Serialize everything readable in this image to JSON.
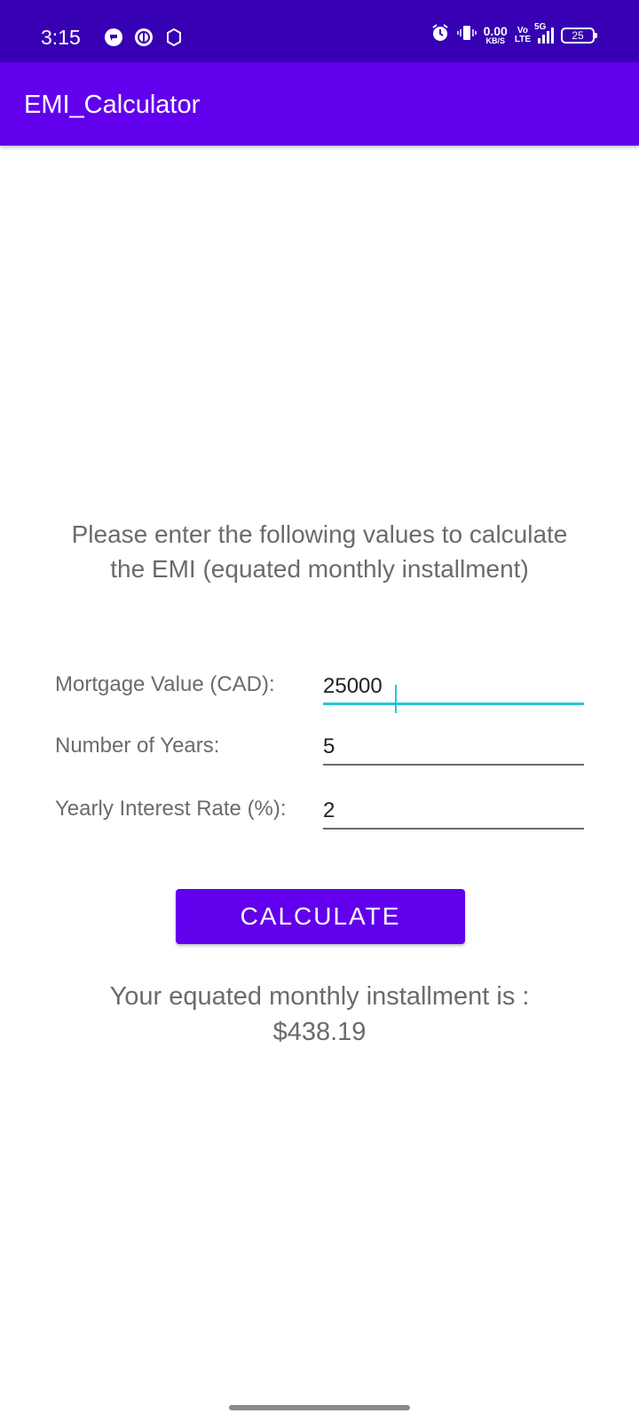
{
  "status_bar": {
    "time": "3:15",
    "left_icons": [
      "app-notification-icon",
      "app-notification-icon",
      "settings-icon"
    ],
    "net_speed_value": "0.00",
    "net_speed_unit": "KB/S",
    "volte_top": "Vo",
    "volte_bottom": "LTE",
    "network_type": "5G",
    "battery_level": "25",
    "background_color": "#3700b3"
  },
  "app_bar": {
    "title": "EMI_Calculator",
    "background_color": "#6200ee"
  },
  "instructions": "Please enter the following values to calculate the EMI (equated monthly installment)",
  "form": {
    "mortgage_label": "Mortgage Value (CAD):",
    "mortgage_value": "25000",
    "years_label": "Number of Years:",
    "years_value": "5",
    "rate_label": "Yearly Interest Rate (%):",
    "rate_value": "2"
  },
  "calculate_button": {
    "label": "CALCULATE",
    "color": "#6200ee"
  },
  "result": {
    "label": "Your equated monthly installment is :",
    "value": "$438.19"
  },
  "colors": {
    "accent_focus": "#26c6da",
    "text_secondary": "#6b6b6b"
  }
}
